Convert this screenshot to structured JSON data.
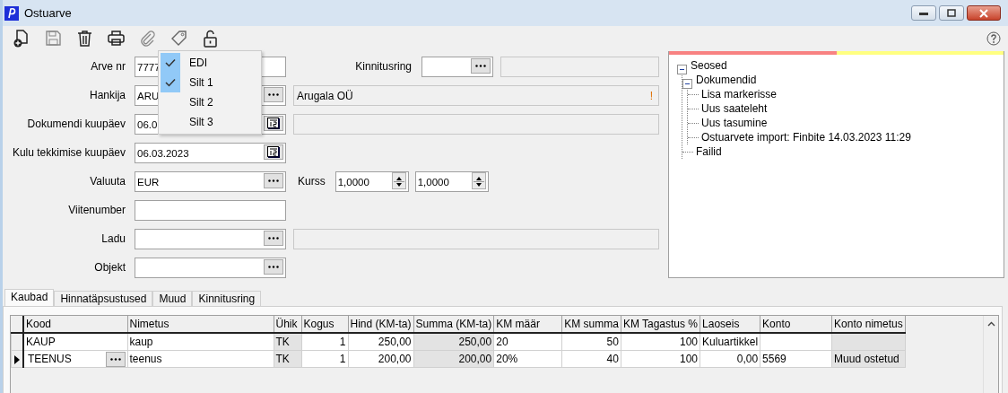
{
  "window": {
    "title": "Ostuarve"
  },
  "toolbar": [
    {
      "kind": "new",
      "disabled": false
    },
    {
      "kind": "save",
      "disabled": true
    },
    {
      "kind": "delete",
      "disabled": false
    },
    {
      "kind": "print",
      "disabled": false
    },
    {
      "kind": "attach",
      "disabled": true
    },
    {
      "kind": "tag",
      "disabled": false
    },
    {
      "kind": "lock",
      "disabled": false
    }
  ],
  "tag_menu": [
    {
      "label": "EDI",
      "checked": true
    },
    {
      "label": "Silt 1",
      "checked": true
    },
    {
      "label": "Silt 2",
      "checked": false
    },
    {
      "label": "Silt 3",
      "checked": false
    }
  ],
  "form": [
    {
      "items": [
        {
          "kind": "label",
          "text": "Arve nr"
        },
        {
          "kind": "text",
          "value": "7777"
        },
        {
          "kind": "side_label",
          "text": "Kinnitusring"
        },
        {
          "kind": "lookup",
          "value": ""
        },
        {
          "kind": "readonly",
          "value": ""
        }
      ]
    },
    {
      "items": [
        {
          "kind": "label",
          "text": "Hankija"
        },
        {
          "kind": "lookup",
          "value": "ARU"
        },
        {
          "kind": "readonly",
          "value": "Arugala OÜ",
          "warning": "!"
        }
      ]
    },
    {
      "items": [
        {
          "kind": "label",
          "text": "Dokumendi kuupäev"
        },
        {
          "kind": "date",
          "value": "06.0"
        },
        {
          "kind": "readonly",
          "value": ""
        }
      ]
    },
    {
      "items": [
        {
          "kind": "label",
          "text": "Kulu tekkimise kuupäev"
        },
        {
          "kind": "date",
          "value": "06.03.2023"
        }
      ]
    },
    {
      "items": [
        {
          "kind": "label",
          "text": "Valuuta"
        },
        {
          "kind": "lookup",
          "value": "EUR"
        },
        {
          "kind": "side_label",
          "text": "Kurss"
        },
        {
          "kind": "spin",
          "value": "1,0000"
        },
        {
          "kind": "spin",
          "value": "1,0000"
        }
      ]
    },
    {
      "items": [
        {
          "kind": "label",
          "text": "Viitenumber"
        },
        {
          "kind": "text",
          "value": ""
        }
      ]
    },
    {
      "items": [
        {
          "kind": "label",
          "text": "Ladu"
        },
        {
          "kind": "lookup",
          "value": ""
        },
        {
          "kind": "readonly",
          "value": ""
        }
      ]
    },
    {
      "items": [
        {
          "kind": "label",
          "text": "Objekt"
        },
        {
          "kind": "lookup",
          "value": ""
        }
      ]
    }
  ],
  "relations": {
    "indicators": [
      {
        "color": "#f88282"
      },
      {
        "color": "#ffff80"
      }
    ],
    "tree": [
      {
        "label": "Seosed",
        "expanded": true,
        "children": [
          {
            "label": "Dokumendid",
            "expanded": true,
            "children": [
              {
                "label": "Lisa markerisse"
              },
              {
                "label": "Uus saateleht"
              },
              {
                "label": "Uus tasumine"
              },
              {
                "label": "Ostuarvete import: Finbite 14.03.2023 11:29"
              }
            ]
          },
          {
            "label": "Failid"
          }
        ]
      }
    ]
  },
  "tabs": [
    {
      "label": "Kaubad",
      "selected": true
    },
    {
      "label": "Hinnatäpsustused",
      "selected": false
    },
    {
      "label": "Muud",
      "selected": false
    },
    {
      "label": "Kinnitusring",
      "selected": false
    }
  ],
  "table": {
    "columns": [
      {
        "name": "Kood"
      },
      {
        "name": "Nimetus"
      },
      {
        "name": "Ühik",
        "readonly": true
      },
      {
        "name": "Kogus",
        "numeric": true
      },
      {
        "name": "Hind (KM-ta)",
        "numeric": true
      },
      {
        "name": "Summa (KM-ta)",
        "numeric": true,
        "readonly": true
      },
      {
        "name": "KM määr"
      },
      {
        "name": "KM summa",
        "numeric": true
      },
      {
        "name": "KM Tagastus %",
        "numeric": true
      },
      {
        "name": "Laoseis",
        "numeric": true
      },
      {
        "name": "Konto"
      },
      {
        "name": "Konto nimetus",
        "readonly": true
      }
    ],
    "rows": [
      {
        "selected": false,
        "cells": [
          "KAUP",
          "kaup",
          "TK",
          "1",
          "250,00",
          "250,00",
          "20",
          "50",
          "100",
          "Kuluartikkel",
          "",
          ""
        ]
      },
      {
        "selected": true,
        "cells": [
          "TEENUS",
          "teenus",
          "TK",
          "1",
          "200,00",
          "200,00",
          "20%",
          "40",
          "100",
          "0,00",
          "5569",
          "Muud ostetud"
        ]
      }
    ]
  }
}
